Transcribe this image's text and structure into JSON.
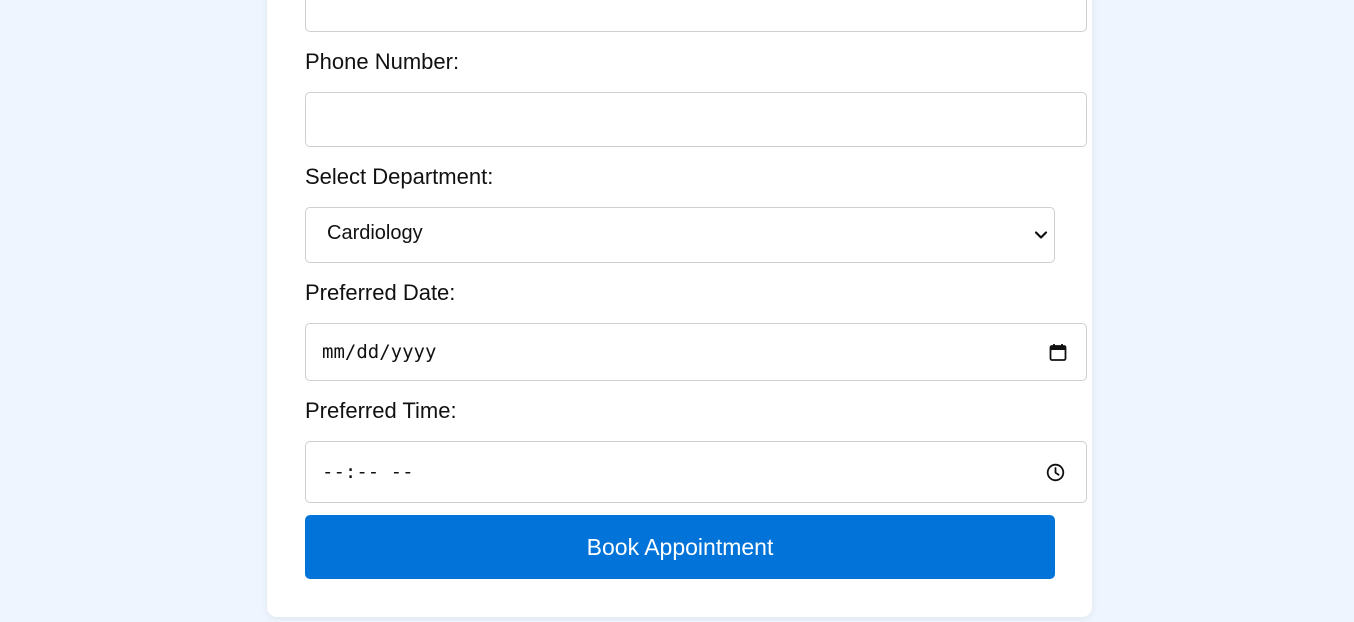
{
  "form": {
    "phone_label": "Phone Number:",
    "phone_value": "",
    "department_label": "Select Department:",
    "department_selected": "Cardiology",
    "date_label": "Preferred Date:",
    "date_placeholder": "mm/dd/yyyy",
    "time_label": "Preferred Time:",
    "time_placeholder": "--:-- --",
    "submit_label": "Book Appointment"
  },
  "icons": {
    "select": "chevron-down-icon",
    "date": "calendar-icon",
    "time": "clock-icon"
  },
  "colors": {
    "background": "#eef5fe",
    "card": "#ffffff",
    "button": "#0274d9",
    "button_text": "#ffffff",
    "border": "#cfcfcf"
  }
}
